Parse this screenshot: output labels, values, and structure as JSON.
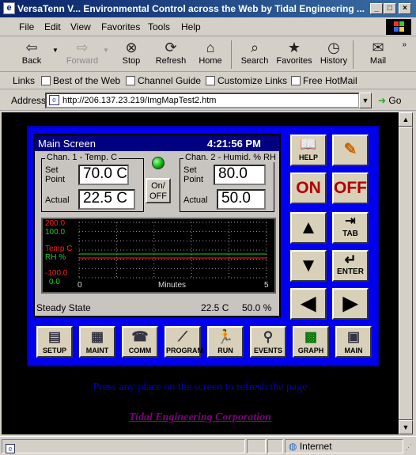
{
  "window": {
    "title": "VersaTenn V... Environmental Control across the Web by Tidal Engineering ..."
  },
  "menu": [
    "File",
    "Edit",
    "View",
    "Favorites",
    "Tools",
    "Help"
  ],
  "toolbar": {
    "back": "Back",
    "forward": "Forward",
    "stop": "Stop",
    "refresh": "Refresh",
    "home": "Home",
    "search": "Search",
    "favorites": "Favorites",
    "history": "History",
    "mail": "Mail"
  },
  "links": {
    "label": "Links",
    "items": [
      "Best of the Web",
      "Channel Guide",
      "Customize Links",
      "Free HotMail"
    ]
  },
  "address": {
    "label": "Address",
    "url": "http://206.137.23.219/ImgMapTest2.htm",
    "go": "Go"
  },
  "status": {
    "zone": "Internet"
  },
  "versatenn": {
    "screen_title": "Main Screen",
    "time": "4:21:56 PM",
    "ch1": {
      "title": "Chan. 1 - Temp. C",
      "setpoint_label_1": "Set",
      "setpoint_label_2": "Point",
      "setpoint": "70.0 C",
      "actual_label": "Actual",
      "actual": "22.5 C"
    },
    "ch2": {
      "title": "Chan. 2 - Humid. % RH",
      "setpoint_label_1": "Set",
      "setpoint_label_2": "Point",
      "setpoint": "80.0",
      "actual_label": "Actual",
      "actual": "50.0"
    },
    "onoff_1": "On/",
    "onoff_2": "OFF",
    "chart": {
      "y_top_red": "200.0",
      "y_top_green": "100.0",
      "mid_red": "Temp C",
      "mid_green": "RH %",
      "y_bot_red": "-100.0",
      "y_bot_green": "0.0",
      "x_left": "0",
      "x_mid": "Minutes",
      "x_right": "5"
    },
    "state": "Steady State",
    "state_temp": "22.5 C",
    "state_rh": "50.0 %",
    "side": {
      "help": "HELP",
      "on": "ON",
      "off": "OFF",
      "tab": "TAB",
      "enter": "ENTER"
    },
    "bottom": [
      "SETUP",
      "MAINT",
      "COMM",
      "PROGRAM",
      "RUN",
      "EVENTS",
      "GRAPH",
      "MAIN"
    ]
  },
  "page": {
    "refresh_text": "Press any place on the screen to refresh the page",
    "company_link": "Tidal Engineering Corporation"
  },
  "colors": {
    "title_bar": "#0a246a",
    "panel_blue": "#0000ee",
    "temp_red": "#ff2020",
    "rh_green": "#20cc20",
    "link_purple": "#800080"
  }
}
